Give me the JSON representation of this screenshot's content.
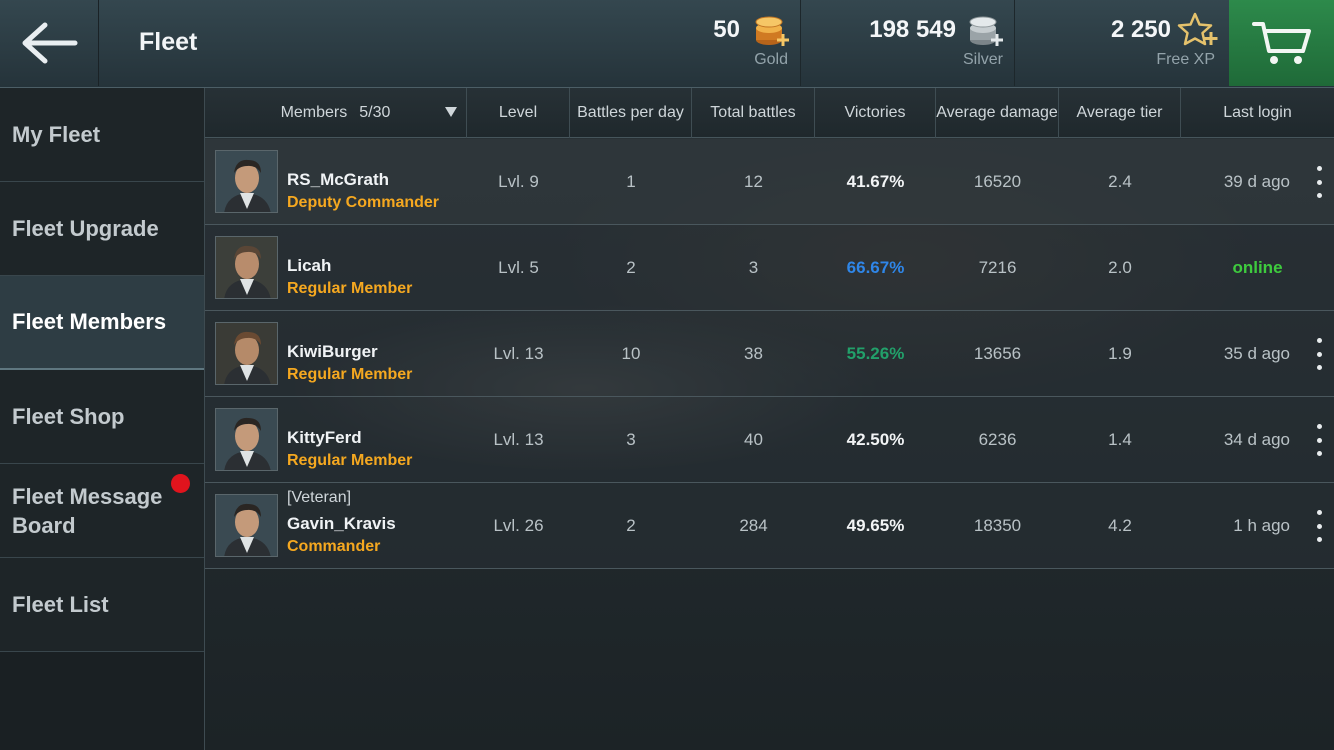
{
  "header": {
    "title": "Fleet",
    "gold": {
      "amount": "50",
      "label": "Gold"
    },
    "silver": {
      "amount": "198 549",
      "label": "Silver"
    },
    "free_xp": {
      "amount": "2 250",
      "label": "Free XP"
    }
  },
  "sidebar": {
    "items": [
      {
        "label": "My Fleet"
      },
      {
        "label": "Fleet Upgrade"
      },
      {
        "label": "Fleet Members",
        "active": true
      },
      {
        "label": "Fleet Shop"
      },
      {
        "label": "Fleet Message Board",
        "line1": "Fleet Message",
        "line2": "Board",
        "has_notification": true
      },
      {
        "label": "Fleet List"
      }
    ]
  },
  "table": {
    "columns": {
      "members": "Members",
      "members_count": "5/30",
      "level": "Level",
      "battles_per_day": "Battles per day",
      "total_battles": "Total battles",
      "victories": "Victories",
      "average_damage": "Average damage",
      "average_tier": "Average tier",
      "last_login": "Last login"
    },
    "rows": [
      {
        "prefix": "",
        "name": "RS_McGrath",
        "role": "Deputy Commander",
        "level": "Lvl. 9",
        "battles_per_day": "1",
        "total_battles": "12",
        "victories": "41.67%",
        "victories_color": "#f2f4f5",
        "average_damage": "16520",
        "average_tier": "2.4",
        "last_login": "39 d ago"
      },
      {
        "prefix": "",
        "name": "Licah",
        "role": "Regular Member",
        "level": "Lvl. 5",
        "battles_per_day": "2",
        "total_battles": "3",
        "victories": "66.67%",
        "victories_color": "#2f86e8",
        "average_damage": "7216",
        "average_tier": "2.0",
        "last_login": "online"
      },
      {
        "prefix": "",
        "name": "KiwiBurger",
        "role": "Regular Member",
        "level": "Lvl. 13",
        "battles_per_day": "10",
        "total_battles": "38",
        "victories": "55.26%",
        "victories_color": "#22a06a",
        "average_damage": "13656",
        "average_tier": "1.9",
        "last_login": "35 d ago"
      },
      {
        "prefix": "",
        "name": "KittyFerd",
        "role": "Regular Member",
        "level": "Lvl. 13",
        "battles_per_day": "3",
        "total_battles": "40",
        "victories": "42.50%",
        "victories_color": "#f2f4f5",
        "average_damage": "6236",
        "average_tier": "1.4",
        "last_login": "34 d ago"
      },
      {
        "prefix": "[Veteran]",
        "name": "Gavin_Kravis",
        "role": "Commander",
        "level": "Lvl. 26",
        "battles_per_day": "2",
        "total_battles": "284",
        "victories": "49.65%",
        "victories_color": "#f2f4f5",
        "average_damage": "18350",
        "average_tier": "4.2",
        "last_login": "1 h ago"
      }
    ]
  },
  "icons": {
    "back": "back-arrow-icon",
    "gold": "gold-coins-icon",
    "silver": "silver-coins-icon",
    "free_xp": "star-icon",
    "cart": "shopping-cart-icon",
    "more": "more-options-icon"
  },
  "colors": {
    "role": "#f5a820",
    "online": "#3ecb3e",
    "cart_bg": "#248044",
    "notification": "#e0141d"
  }
}
